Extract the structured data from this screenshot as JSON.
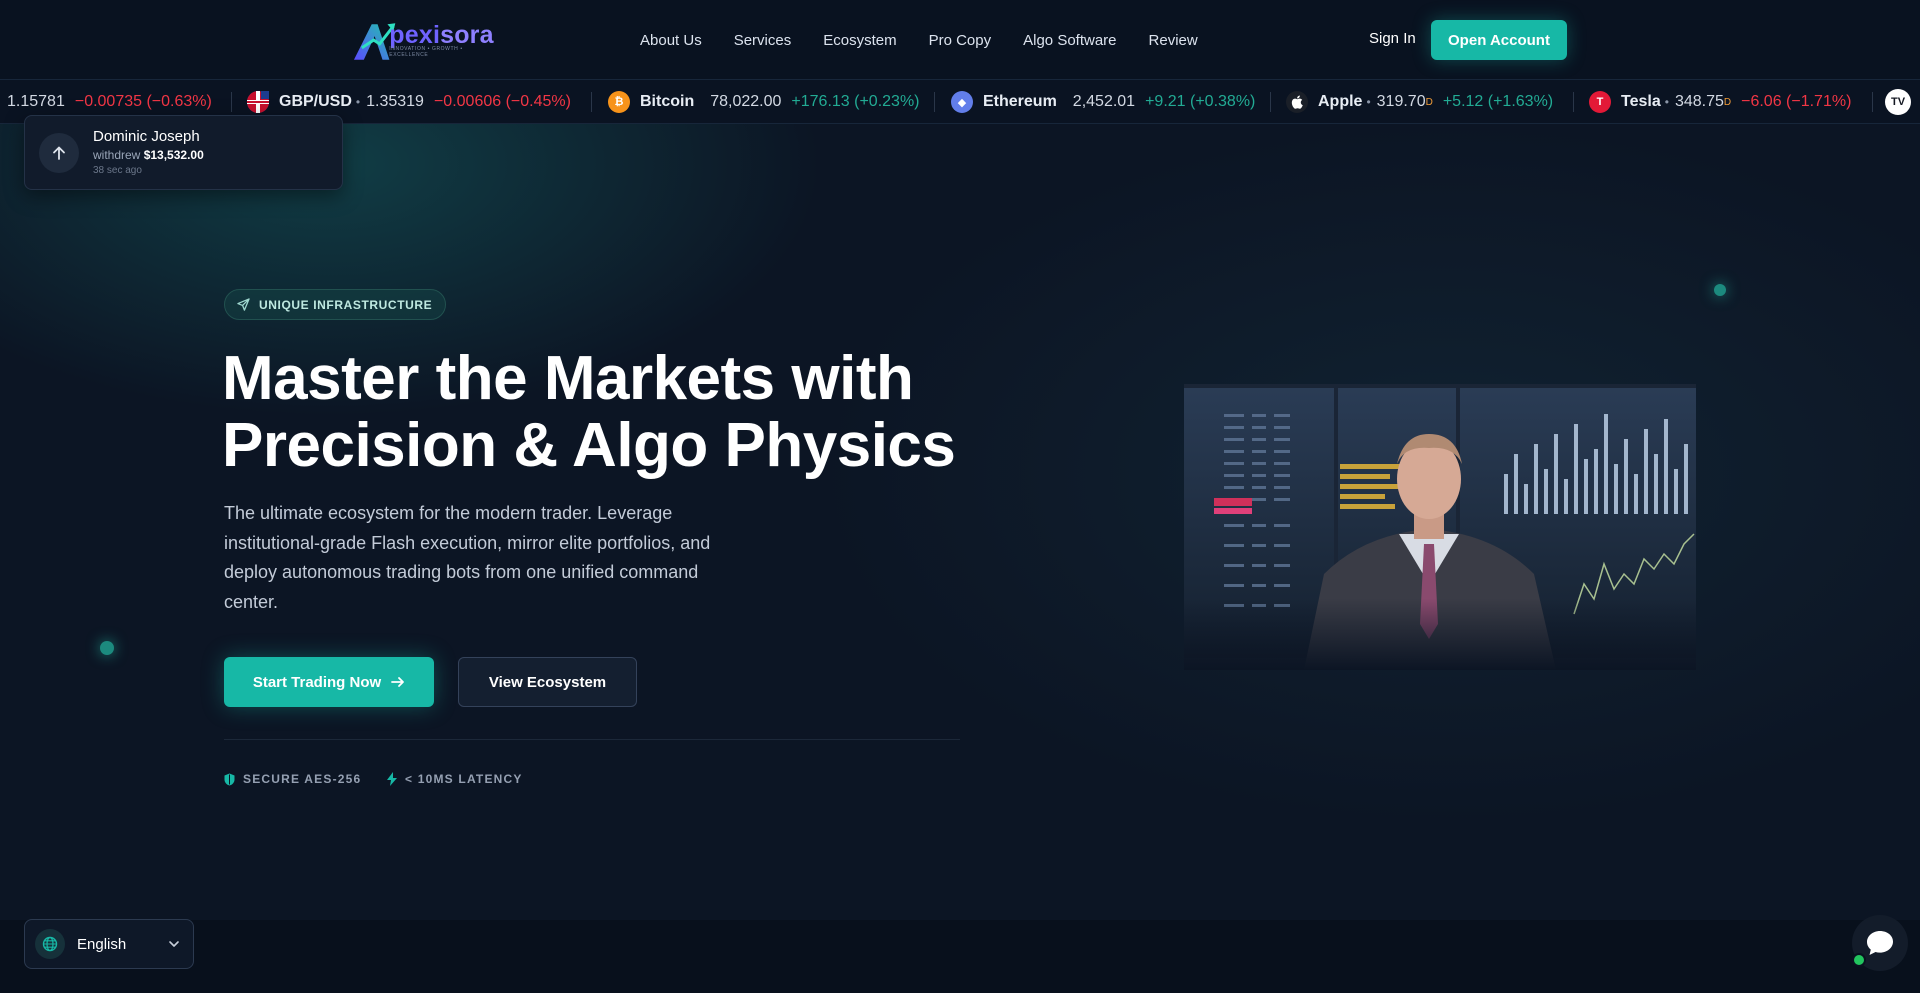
{
  "brand": {
    "name_part1": "pexi",
    "name_part2": "sora",
    "tagline": "INNOVATION • GROWTH • EXCELLENCE",
    "accent": "#17b8a6",
    "logo_color": "#6f63ff"
  },
  "nav": {
    "items": [
      "About Us",
      "Services",
      "Ecosystem",
      "Pro Copy",
      "Algo Software",
      "Review"
    ],
    "sign_in": "Sign In",
    "open_account": "Open Account"
  },
  "ticker": [
    {
      "name": "",
      "price": "1.15781",
      "change": "−0.00735 (−0.63%)",
      "direction": "down"
    },
    {
      "name": "GBP/USD",
      "price": "1.35319",
      "change": "−0.00606 (−0.45%)",
      "direction": "down",
      "icon": "gbp-usd-flag-icon"
    },
    {
      "name": "Bitcoin",
      "price": "78,022.00",
      "change": "+176.13 (+0.23%)",
      "direction": "up",
      "icon": "bitcoin-icon"
    },
    {
      "name": "Ethereum",
      "price": "2,452.01",
      "change": "+9.21 (+0.38%)",
      "direction": "up",
      "icon": "ethereum-icon"
    },
    {
      "name": "Apple",
      "price": "319.70",
      "suffix": "D",
      "change": "+5.12 (+1.63%)",
      "direction": "up",
      "icon": "apple-icon"
    },
    {
      "name": "Tesla",
      "price": "348.75",
      "suffix": "D",
      "change": "−6.06 (−1.71%)",
      "direction": "down",
      "icon": "tesla-icon"
    }
  ],
  "toast": {
    "name": "Dominic Joseph",
    "action": "withdrew",
    "amount": "$13,532.00",
    "time": "38 sec ago"
  },
  "hero": {
    "badge": "UNIQUE INFRASTRUCTURE",
    "headline_line1": "Master the Markets with",
    "headline_line2": "Precision & Algo Physics",
    "subtext": "The ultimate ecosystem for the modern trader. Leverage institutional-grade Flash execution, mirror elite portfolios, and deploy autonomous trading bots from one unified command center.",
    "primary_cta": "Start Trading Now",
    "secondary_cta": "View Ecosystem",
    "features": [
      "SECURE AES-256",
      "< 10MS LATENCY"
    ]
  },
  "language": {
    "selected": "English"
  },
  "colors": {
    "positive": "#22ab94",
    "negative": "#f23645",
    "background": "#0c1524"
  }
}
